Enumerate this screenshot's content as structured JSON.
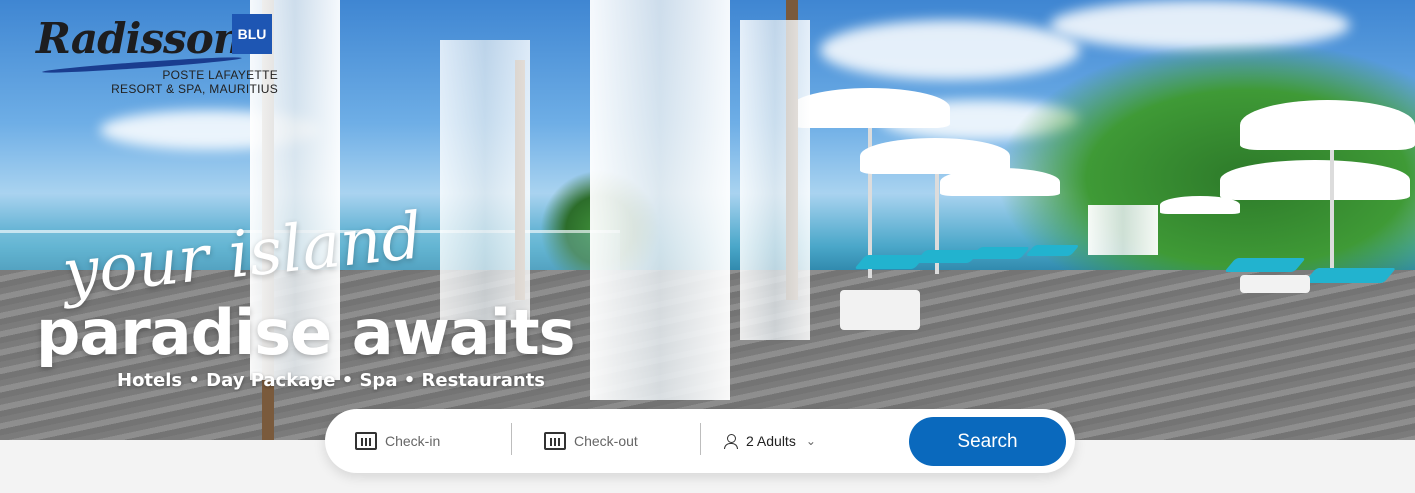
{
  "brand": {
    "logo_script": "Radisson",
    "logo_badge": "BLU",
    "subtitle_line1": "POSTE LAFAYETTE",
    "subtitle_line2": "RESORT & SPA, MAURITIUS"
  },
  "hero": {
    "script_line": "your island",
    "headline": "paradise awaits",
    "services": "Hotels • Day Package • Spa • Restaurants"
  },
  "search": {
    "checkin_placeholder": "Check-in",
    "checkout_placeholder": "Check-out",
    "guests_value": "2 Adults",
    "button_label": "Search",
    "accent_color": "#0a69bd"
  },
  "icons": {
    "checkin": "calendar-icon",
    "checkout": "calendar-icon",
    "guests": "person-icon",
    "dropdown": "chevron-down-icon"
  }
}
